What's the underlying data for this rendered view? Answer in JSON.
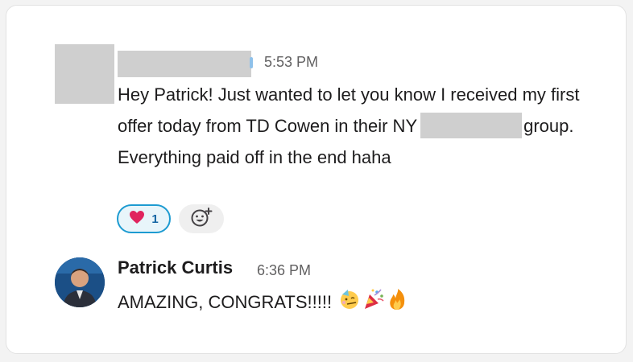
{
  "message1": {
    "time": "5:53 PM",
    "text_part1": "Hey Patrick! Just wanted to let you know I received my first offer today from TD Cowen in their NY",
    "text_part2": "group. Everything paid off in the end haha",
    "reaction": {
      "emoji": "heart-emoji",
      "count": "1"
    },
    "add_reaction_icon": "add-emoji-icon"
  },
  "message2": {
    "sender": "Patrick Curtis",
    "time": "6:36 PM",
    "text": "AMAZING, CONGRATS!!!!!",
    "emojis": [
      "partying-face-emoji",
      "party-popper-emoji",
      "fire-emoji"
    ]
  },
  "colors": {
    "background": "#f3f3f3",
    "card": "#ffffff",
    "reaction_border": "#1d9bd1",
    "reaction_fill": "#e8f5fa",
    "redaction": "#cfcfcf"
  }
}
